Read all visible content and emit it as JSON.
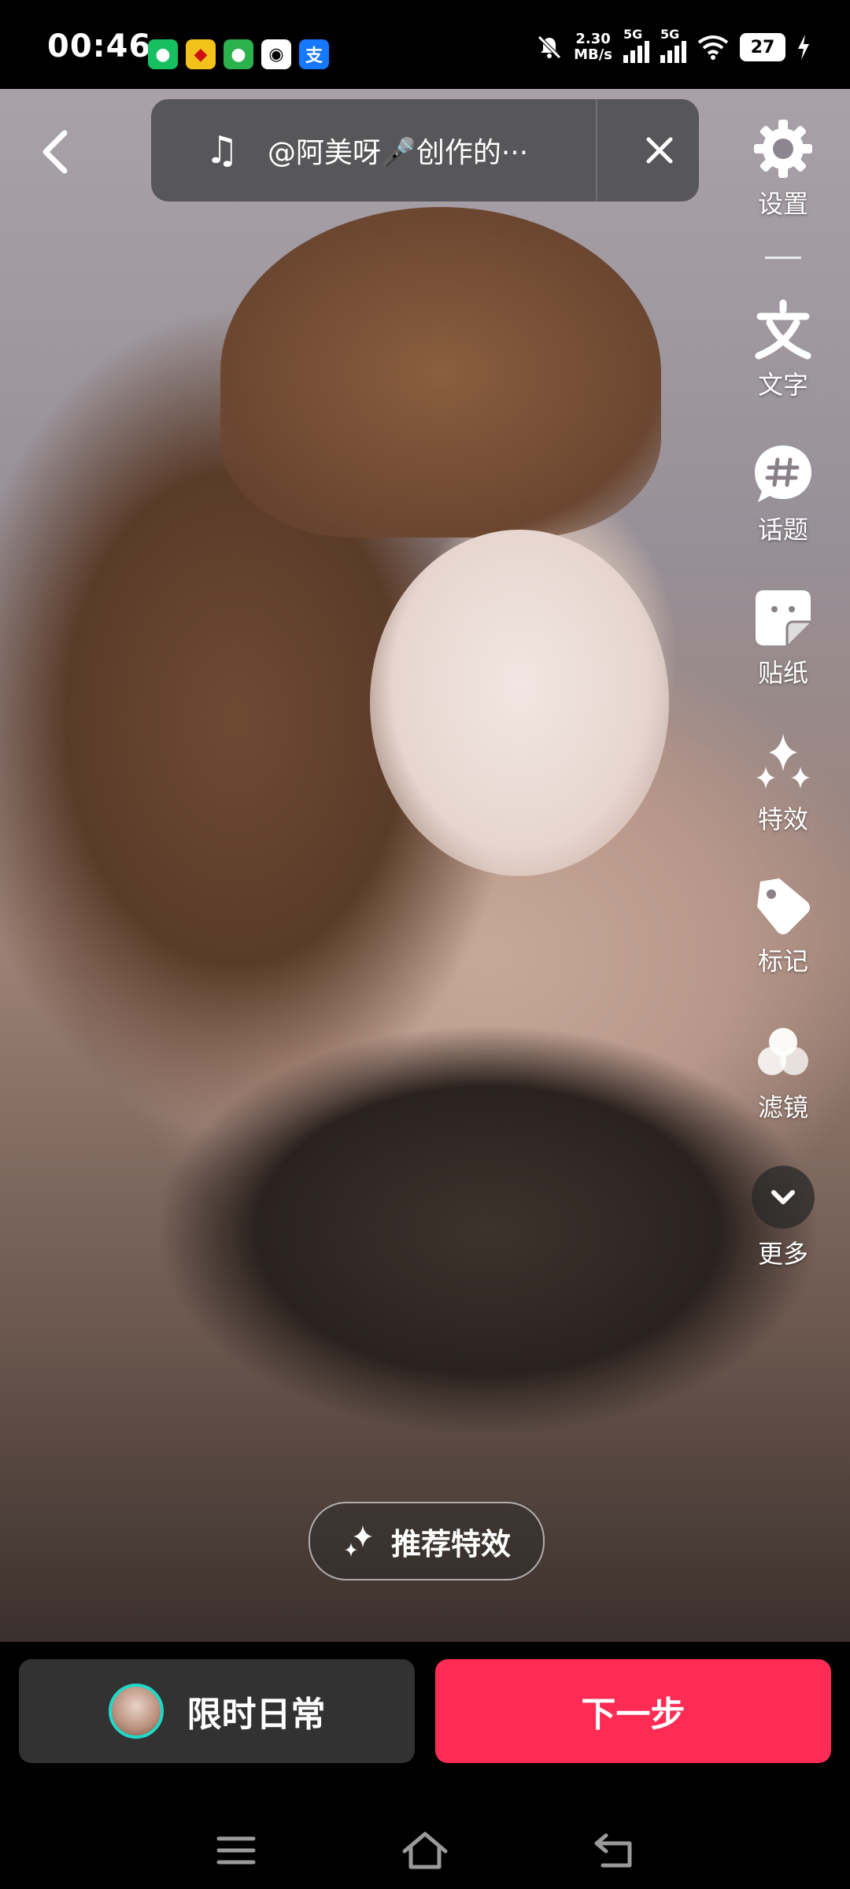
{
  "status_bar": {
    "time": "00:46",
    "app_icons": [
      {
        "name": "wechat-icon",
        "glyph": "●",
        "bg": "#16c060"
      },
      {
        "name": "game-app-icon",
        "glyph": "◆",
        "bg": "#f2c21b"
      },
      {
        "name": "wechat-work-icon",
        "glyph": "●",
        "bg": "#2bb24c"
      },
      {
        "name": "qq-icon",
        "glyph": "◉",
        "bg": "#ffffff"
      },
      {
        "name": "alipay-icon",
        "glyph": "支",
        "bg": "#1677ff"
      }
    ],
    "net_speed_value": "2.30",
    "net_speed_unit": "MB/s",
    "signal1_label": "5G",
    "signal2_label": "5G",
    "battery": "27"
  },
  "music": {
    "title": "@阿美呀🎤创作的···"
  },
  "tools": [
    {
      "name": "settings",
      "label": "设置",
      "icon": "gear-icon"
    },
    {
      "name": "text",
      "label": "文字",
      "icon": "text-icon"
    },
    {
      "name": "topic",
      "label": "话题",
      "icon": "hashtag-icon"
    },
    {
      "name": "sticker",
      "label": "贴纸",
      "icon": "sticker-icon"
    },
    {
      "name": "effects",
      "label": "特效",
      "icon": "sparkle-icon"
    },
    {
      "name": "tag",
      "label": "标记",
      "icon": "tag-icon"
    },
    {
      "name": "filter",
      "label": "滤镜",
      "icon": "filter-icon"
    },
    {
      "name": "more",
      "label": "更多",
      "icon": "chevron-down-icon"
    }
  ],
  "recommend_effects_label": "推荐特效",
  "bottom": {
    "limited_label": "限时日常",
    "next_label": "下一步"
  },
  "colors": {
    "accent": "#fe2c55",
    "dark_button": "#323232",
    "avatar_ring": "#20d8c8"
  }
}
